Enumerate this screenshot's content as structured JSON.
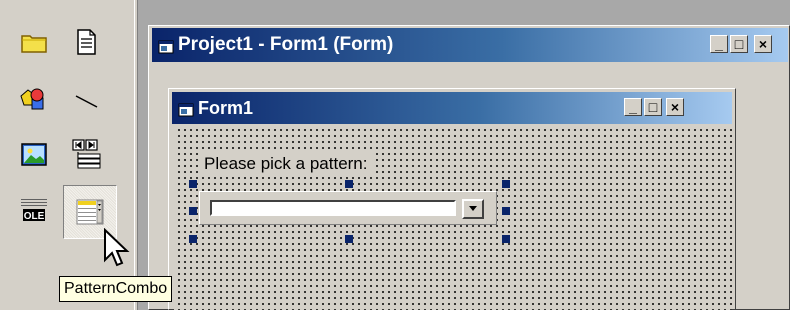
{
  "project_window": {
    "title": "Project1 - Form1 (Form)"
  },
  "form_window": {
    "title": "Form1"
  },
  "form": {
    "label_text": "Please pick a pattern:",
    "combo_value": ""
  },
  "toolbox": {
    "items": [
      {
        "icon": "frame-icon"
      },
      {
        "icon": "text-box-icon"
      },
      {
        "icon": "shape-icon"
      },
      {
        "icon": "line-icon"
      },
      {
        "icon": "image-icon"
      },
      {
        "icon": "data-icon"
      },
      {
        "icon": "ole-icon",
        "text": "OLE"
      },
      {
        "icon": "pattern-combo-icon",
        "selected": true
      }
    ]
  },
  "tooltip": {
    "text": "PatternCombo"
  },
  "window_buttons": {
    "minimize": "_",
    "maximize": "□",
    "close": "×"
  },
  "colors": {
    "titlebar_start": "#0a246a",
    "titlebar_end": "#a6caf0",
    "tooltip_bg": "#ffffe1"
  }
}
